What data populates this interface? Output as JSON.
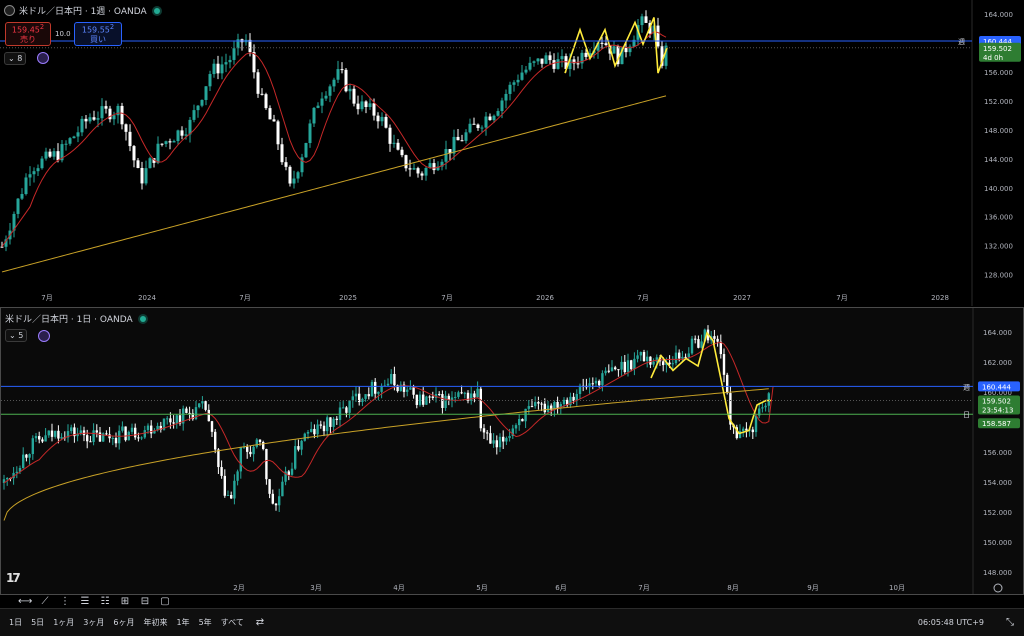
{
  "top": {
    "title": "米ドル／日本円 · 1週 · OANDA",
    "sell_price": "159.45",
    "sell_suffix": "2",
    "sell_label": "売り",
    "spread": "10.0",
    "buy_price": "159.55",
    "buy_suffix": "2",
    "buy_label": "買い",
    "indicator_count": "8",
    "y_ticks": [
      "164.000",
      "160.000",
      "156.000",
      "152.000",
      "148.000",
      "144.000",
      "140.000",
      "136.000",
      "132.000",
      "128.000"
    ],
    "x_ticks": [
      "7月",
      "2024",
      "7月",
      "2025",
      "7月",
      "2026",
      "7月",
      "2027",
      "7月",
      "2028"
    ],
    "week_tag": "週",
    "week_level": "160.444",
    "last_price": "159.502",
    "countdown": "4d 0h"
  },
  "bottom": {
    "title": "米ドル／日本円 · 1日 · OANDA",
    "indicator_count": "5",
    "y_ticks": [
      "164.000",
      "162.000",
      "160.000",
      "158.000",
      "156.000",
      "154.000",
      "152.000",
      "150.000",
      "148.000"
    ],
    "x_ticks": [
      "2月",
      "3月",
      "4月",
      "5月",
      "6月",
      "7月",
      "8月",
      "9月",
      "10月"
    ],
    "week_tag": "週",
    "week_level": "160.444",
    "last_price": "159.502",
    "countdown": "23:54:13",
    "day_tag": "日",
    "day_level": "158.587"
  },
  "timeframes": [
    "1日",
    "5日",
    "1ヶ月",
    "3ヶ月",
    "6ヶ月",
    "年初来",
    "1年",
    "5年",
    "すべて"
  ],
  "clock": "06:05:48 UTC+9",
  "colors": {
    "up": "#26a69a",
    "down": "#ffffff",
    "ma_fast": "#c62828",
    "ma_slow": "#c9a227",
    "week": "#2962ff",
    "day": "#4caf50",
    "zigzag": "#ffeb3b"
  }
}
